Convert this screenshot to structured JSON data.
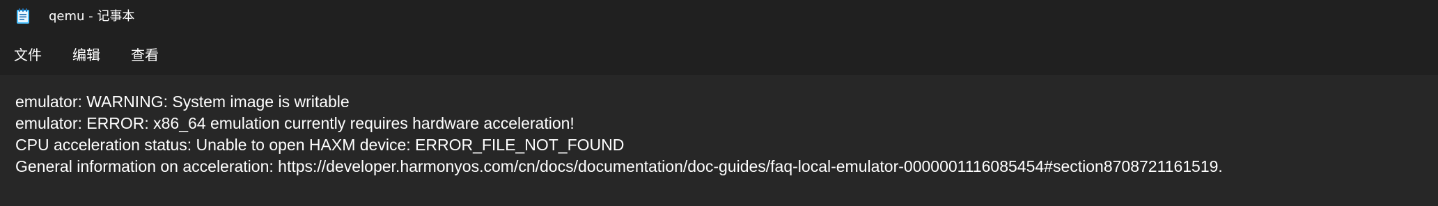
{
  "window": {
    "title": "qemu - 记事本",
    "icon": "notepad-icon"
  },
  "menu": {
    "file": "文件",
    "edit": "编辑",
    "view": "查看"
  },
  "editor": {
    "lines": [
      "emulator: WARNING: System image is writable",
      "emulator: ERROR: x86_64 emulation currently requires hardware acceleration!",
      "CPU acceleration status: Unable to open HAXM device: ERROR_FILE_NOT_FOUND",
      "General information on acceleration: https://developer.harmonyos.com/cn/docs/documentation/doc-guides/faq-local-emulator-0000001116085454#section8708721161519."
    ]
  },
  "colors": {
    "chrome_bg": "#202020",
    "editor_bg": "#272727",
    "text": "#ffffff",
    "icon_accent": "#4cc2ff"
  }
}
